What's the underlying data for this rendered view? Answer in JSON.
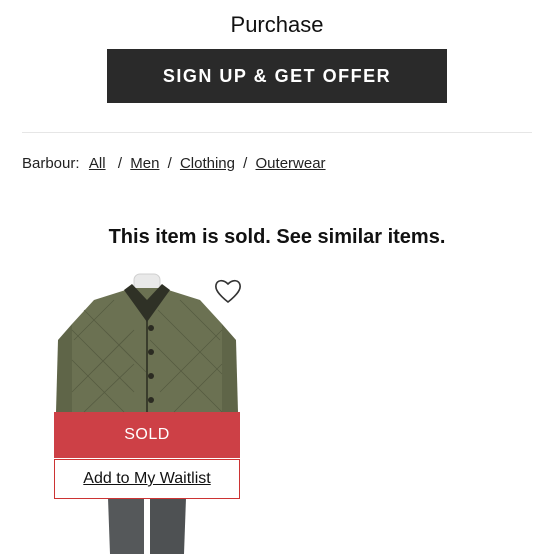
{
  "header": {
    "title": "Purchase",
    "signup_button": "SIGN UP & GET OFFER"
  },
  "breadcrumb": {
    "brand": "Barbour:",
    "items": [
      "All",
      "Men",
      "Clothing",
      "Outerwear"
    ]
  },
  "listing": {
    "status_message": "This item is sold. See similar items.",
    "sold_label": "SOLD",
    "waitlist_label": "Add to My Waitlist",
    "favorite_icon": "heart-icon",
    "product_image": "olive quilted jacket with dark corduroy collar on mannequin"
  },
  "colors": {
    "button_bg": "#2a2a2a",
    "sold_red": "#c41e26",
    "jacket_olive": "#6b7152",
    "collar_dark": "#2f3126"
  }
}
